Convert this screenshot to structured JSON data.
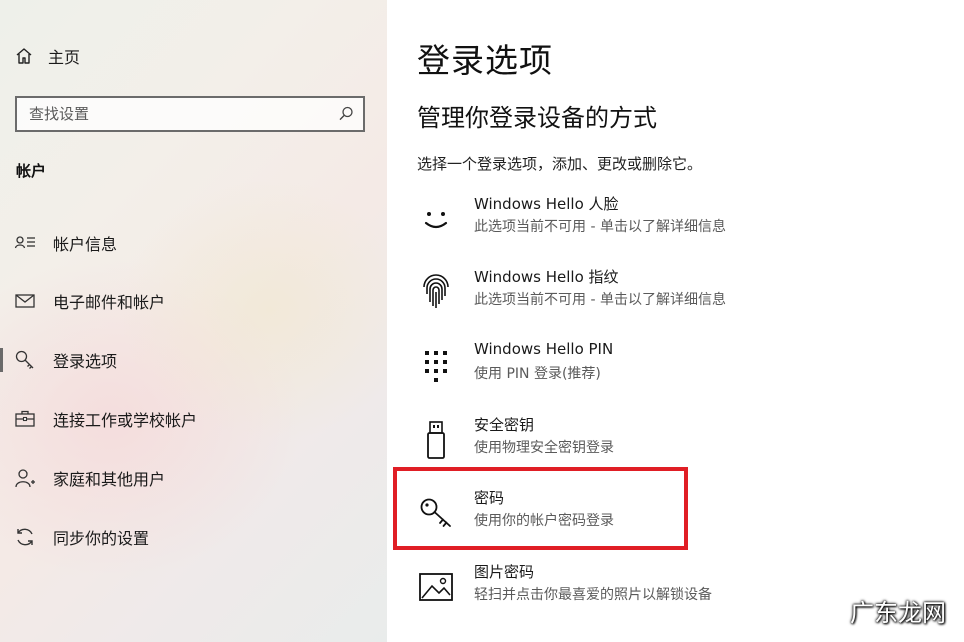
{
  "sidebar": {
    "home_label": "主页",
    "search_placeholder": "查找设置",
    "section_label": "帐户",
    "items": [
      {
        "label": "帐户信息",
        "icon": "person-card-icon"
      },
      {
        "label": "电子邮件和帐户",
        "icon": "mail-icon"
      },
      {
        "label": "登录选项",
        "icon": "key-icon"
      },
      {
        "label": "连接工作或学校帐户",
        "icon": "briefcase-icon"
      },
      {
        "label": "家庭和其他用户",
        "icon": "person-add-icon"
      },
      {
        "label": "同步你的设置",
        "icon": "sync-icon"
      }
    ],
    "active_index": 2
  },
  "main": {
    "title": "登录选项",
    "subtitle": "管理你登录设备的方式",
    "description": "选择一个登录选项，添加、更改或删除它。",
    "options": [
      {
        "title": "Windows Hello 人脸",
        "subtitle": "此选项当前不可用 - 单击以了解详细信息",
        "icon": "smiley-face-icon"
      },
      {
        "title": "Windows Hello 指纹",
        "subtitle": "此选项当前不可用 - 单击以了解详细信息",
        "icon": "fingerprint-icon"
      },
      {
        "title": "Windows Hello PIN",
        "subtitle": "使用 PIN 登录(推荐)",
        "icon": "pin-keypad-icon"
      },
      {
        "title": "安全密钥",
        "subtitle": "使用物理安全密钥登录",
        "icon": "usb-key-icon"
      },
      {
        "title": "密码",
        "subtitle": "使用你的帐户密码登录",
        "icon": "key-icon"
      },
      {
        "title": "图片密码",
        "subtitle": "轻扫并点击你最喜爱的照片以解锁设备",
        "icon": "picture-icon"
      }
    ],
    "highlight_color": "#e01e25"
  },
  "watermark": "广东龙网"
}
